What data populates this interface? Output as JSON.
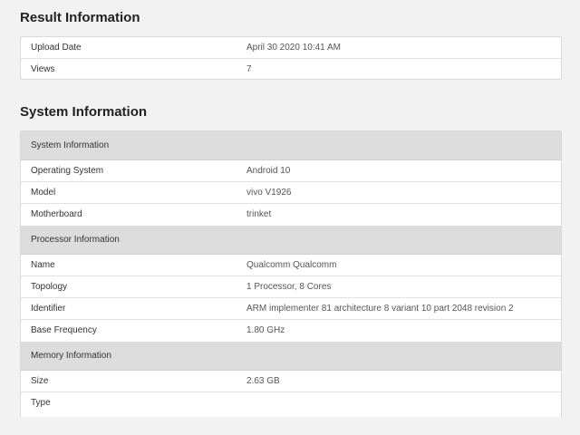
{
  "result_section": {
    "title": "Result Information",
    "rows": [
      {
        "label": "Upload Date",
        "value": "April 30 2020 10:41 AM"
      },
      {
        "label": "Views",
        "value": "7"
      }
    ]
  },
  "system_section": {
    "title": "System Information",
    "groups": [
      {
        "header": "System Information",
        "rows": [
          {
            "label": "Operating System",
            "value": "Android 10"
          },
          {
            "label": "Model",
            "value": "vivo V1926"
          },
          {
            "label": "Motherboard",
            "value": "trinket"
          }
        ]
      },
      {
        "header": "Processor Information",
        "rows": [
          {
            "label": "Name",
            "value": "Qualcomm Qualcomm"
          },
          {
            "label": "Topology",
            "value": "1 Processor, 8 Cores"
          },
          {
            "label": "Identifier",
            "value": "ARM implementer 81 architecture 8 variant 10 part 2048 revision 2"
          },
          {
            "label": "Base Frequency",
            "value": "1.80 GHz"
          }
        ]
      },
      {
        "header": "Memory Information",
        "rows": [
          {
            "label": "Size",
            "value": "2.63 GB"
          },
          {
            "label": "Type",
            "value": ""
          }
        ]
      }
    ]
  }
}
